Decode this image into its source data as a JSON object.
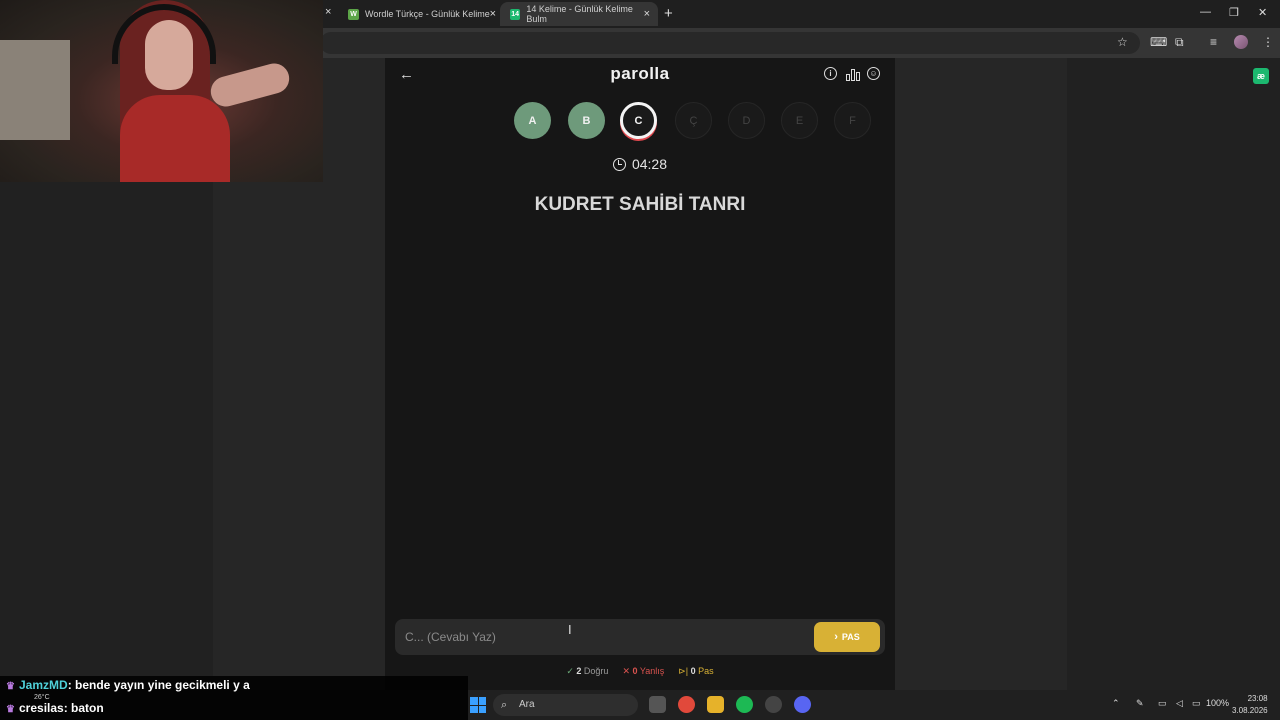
{
  "browser": {
    "tabs": [
      {
        "title": "Wordle Türkçe - Günlük Kelime",
        "favicon": "W",
        "favicon_color": "#5ca548"
      },
      {
        "title": "14 Kelime - Günlük Kelime Bulm",
        "favicon": "14",
        "favicon_color": "#1cb86f"
      }
    ],
    "close_glyph": "×",
    "new_tab_glyph": "+"
  },
  "app": {
    "logo": "parolla",
    "letters": [
      {
        "char": "A",
        "state": "done"
      },
      {
        "char": "B",
        "state": "done"
      },
      {
        "char": "C",
        "state": "current"
      },
      {
        "char": "Ç",
        "state": "pending"
      },
      {
        "char": "D",
        "state": "pending"
      },
      {
        "char": "E",
        "state": "pending"
      },
      {
        "char": "F",
        "state": "pending"
      }
    ],
    "timer": "04:28",
    "question": "KUDRET SAHİBİ TANRI",
    "answer_placeholder": "C... (Cevabı Yaz)",
    "pass_label": "PAS",
    "stats": {
      "correct_count": "2",
      "correct_label": "Doğru",
      "wrong_count": "0",
      "wrong_label": "Yanlış",
      "pass_count": "0",
      "pass_label": "Pas"
    }
  },
  "chat": [
    {
      "user": "JamzMD",
      "message": ": bende yayın yine gecikmeli y a"
    },
    {
      "user": "cresilas",
      "message": ": baton"
    }
  ],
  "taskbar": {
    "search_label": "Ara",
    "weather": "26°C",
    "battery": "100%",
    "time": "23:08",
    "date": "3.08.2026"
  },
  "colors": {
    "done": "#6e9a7b",
    "current_ring": "#f4f4f4",
    "current_underline": "#e0484e",
    "pass_button": "#d8b135",
    "correct": "#6aa877",
    "wrong": "#d9534f"
  }
}
